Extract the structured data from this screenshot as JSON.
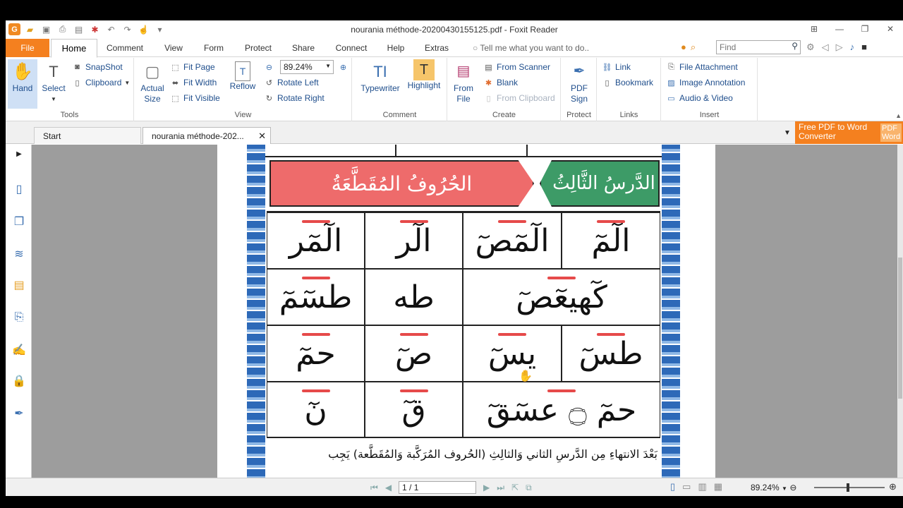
{
  "window": {
    "title": "nourania méthode-20200430155125.pdf - Foxit Reader"
  },
  "menu": {
    "file": "File",
    "tabs": [
      "Home",
      "Comment",
      "View",
      "Form",
      "Protect",
      "Share",
      "Connect",
      "Help",
      "Extras"
    ],
    "tell_me": "Tell me what you want to do..",
    "find_placeholder": "Find"
  },
  "ribbon": {
    "tools": {
      "label": "Tools",
      "hand": "Hand",
      "select": "Select",
      "snapshot": "SnapShot",
      "clipboard": "Clipboard"
    },
    "view": {
      "label": "View",
      "actual_size_1": "Actual",
      "actual_size_2": "Size",
      "fit_page": "Fit Page",
      "fit_width": "Fit Width",
      "fit_visible": "Fit Visible",
      "reflow": "Reflow",
      "zoom_value": "89.24%",
      "rotate_left": "Rotate Left",
      "rotate_right": "Rotate Right"
    },
    "comment": {
      "label": "Comment",
      "typewriter": "Typewriter",
      "highlight": "Highlight"
    },
    "create": {
      "label": "Create",
      "from_file_1": "From",
      "from_file_2": "File",
      "from_scanner": "From Scanner",
      "blank": "Blank",
      "from_clipboard": "From Clipboard"
    },
    "protect": {
      "label": "Protect",
      "pdf_sign_1": "PDF",
      "pdf_sign_2": "Sign"
    },
    "links": {
      "label": "Links",
      "link": "Link",
      "bookmark": "Bookmark"
    },
    "insert": {
      "label": "Insert",
      "file_attachment": "File Attachment",
      "image_annotation": "Image Annotation",
      "audio_video": "Audio & Video"
    }
  },
  "doc_tabs": {
    "start": "Start",
    "current": "nourania méthode-202...",
    "close": "✕",
    "promo_1": "Free PDF to Word",
    "promo_2": "Converter",
    "promo_badge_1": "PDF",
    "promo_badge_2": "Word"
  },
  "document": {
    "lesson_title": "الدَّرسُ الثَّالِثُ",
    "lesson_subject": "الحُرُوفُ المُقَطَّعَةُ",
    "rows": [
      [
        "الٓمٓ",
        "الٓمٓصٓ",
        "الٓر",
        "الٓمٓر"
      ],
      [
        "كٓهيعٓصٓ",
        "طه",
        "طسٓمٓ"
      ],
      [
        "طسٓ",
        "يسٓ",
        "صٓ",
        "حمٓ"
      ],
      [
        "حمٓ ۝ عسٓقٓ",
        "قٓ",
        "نٓ"
      ]
    ],
    "footer_line": "بَعْدَ الانتهاءِ مِن الدَّرسِ الثاني وَالثالِثِ (الحُروف المُرَكَّبة وَالمُقَطَّعة) يَجِب"
  },
  "status": {
    "page": "1 / 1",
    "zoom": "89.24%"
  },
  "colors": {
    "accent": "#f4801f",
    "header_red": "#ee6b6b",
    "header_green": "#3d9b67",
    "doc_bg": "#9d9d9d"
  }
}
